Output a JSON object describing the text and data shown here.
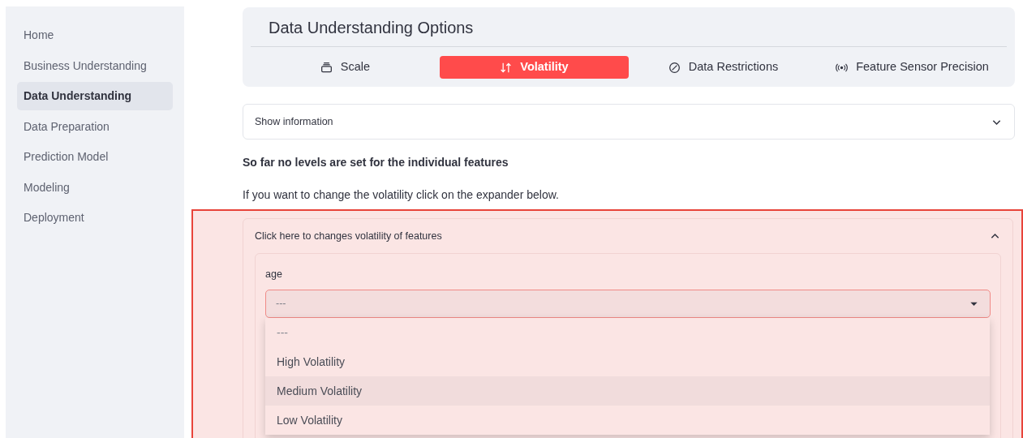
{
  "sidebar": {
    "items": [
      {
        "label": "Home",
        "selected": false
      },
      {
        "label": "Business Understanding",
        "selected": false
      },
      {
        "label": "Data Understanding",
        "selected": true
      },
      {
        "label": "Data Preparation",
        "selected": false
      },
      {
        "label": "Prediction Model",
        "selected": false
      },
      {
        "label": "Modeling",
        "selected": false
      },
      {
        "label": "Deployment",
        "selected": false
      }
    ]
  },
  "options_menu": {
    "title": "Data Understanding Options",
    "tabs": [
      {
        "label": "Scale",
        "selected": false
      },
      {
        "label": "Volatility",
        "selected": true
      },
      {
        "label": "Data Restrictions",
        "selected": false
      },
      {
        "label": "Feature Sensor Precision",
        "selected": false
      }
    ]
  },
  "info_expander": {
    "label": "Show information",
    "expanded": false
  },
  "status_text": "So far no levels are set for the individual features",
  "hint_text": "If you want to change the volatility click on the expander below.",
  "volatility_expander": {
    "label": "Click here to changes volatility of features",
    "expanded": true,
    "feature": {
      "label": "age",
      "value": "---",
      "open": true,
      "options": [
        {
          "label": "---",
          "highlighted": false
        },
        {
          "label": "High Volatility",
          "highlighted": false
        },
        {
          "label": "Medium Volatility",
          "highlighted": true
        },
        {
          "label": "Low Volatility",
          "highlighted": false
        }
      ]
    }
  }
}
